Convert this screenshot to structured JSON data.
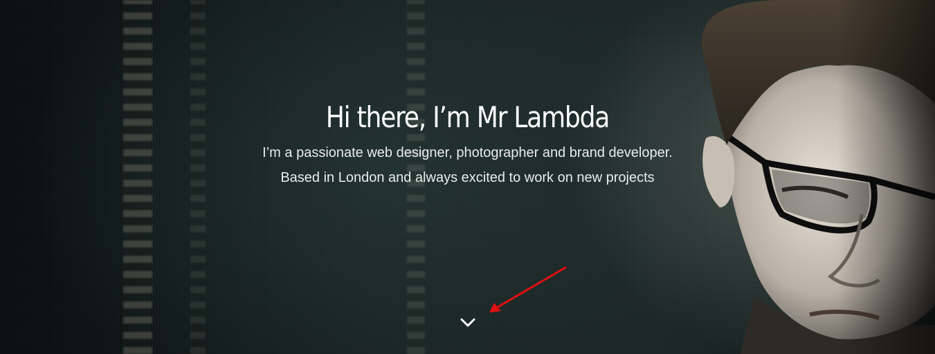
{
  "hero": {
    "title": "Hi there, I’m Mr Lambda",
    "subtitle_line1": "I’m a passionate web designer, photographer and brand developer.",
    "subtitle_line2": "Based in London and always excited to work on new projects",
    "scroll_icon": "chevron-down-icon"
  },
  "annotation": {
    "icon": "arrow-icon",
    "color": "#e01010"
  },
  "colors": {
    "background": "#16201f",
    "text": "#ffffff"
  }
}
